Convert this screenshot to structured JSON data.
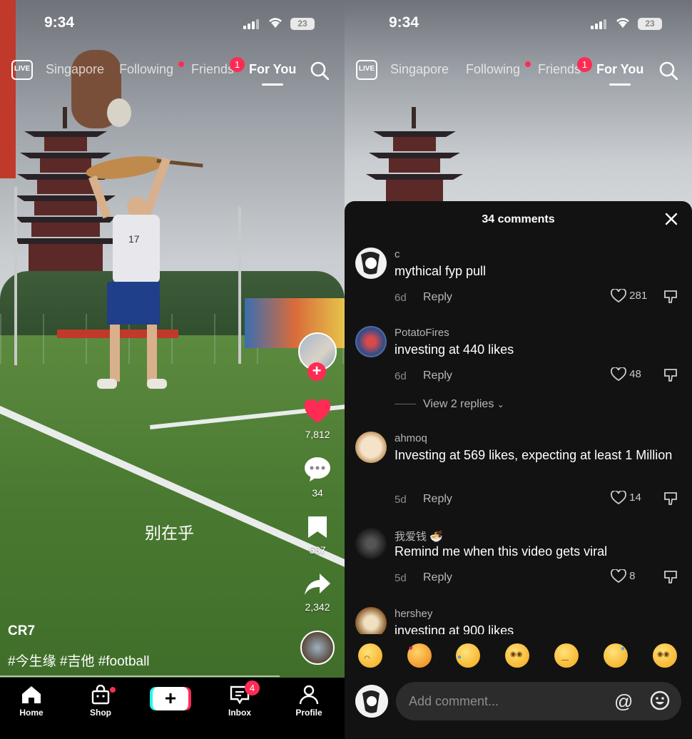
{
  "status_bar": {
    "time": "9:34",
    "battery": "23"
  },
  "top_nav": {
    "live_label": "LIVE",
    "tabs": [
      "Singapore",
      "Following",
      "Friends",
      "For You"
    ],
    "friends_badge": "1"
  },
  "video": {
    "overlay_text": "别在乎",
    "username": "CR7",
    "caption": "#今生缘 #吉他 #football",
    "likes": "7,812",
    "comments": "34",
    "saves": "587",
    "shares": "2,342"
  },
  "bottom_nav": {
    "items": [
      "Home",
      "Shop",
      "Inbox",
      "Profile"
    ],
    "inbox_badge": "4",
    "create_label": "+"
  },
  "comments_panel": {
    "title": "34 comments",
    "reply_label": "Reply",
    "view_replies": "View 2 replies",
    "comments": [
      {
        "user": "c",
        "text": "mythical fyp pull",
        "age": "6d",
        "likes": "281"
      },
      {
        "user": "PotatoFires",
        "text": "investing at 440 likes",
        "age": "6d",
        "likes": "48"
      },
      {
        "user": "ahmoq",
        "text": "Investing at 569 likes, expecting at least 1 Million",
        "age": "5d",
        "likes": "14"
      },
      {
        "user": "我爱钱 🍜",
        "text": "Remind me when this video gets viral",
        "age": "5d",
        "likes": "8"
      },
      {
        "user": "hershey",
        "text": "investing at 900 likes",
        "age": "",
        "likes": ""
      }
    ],
    "input_placeholder": "Add comment...",
    "mention_symbol": "@"
  },
  "colors": {
    "accent": "#fe2c55",
    "sheet_bg": "#121212",
    "input_bg": "#2c2c2c"
  }
}
